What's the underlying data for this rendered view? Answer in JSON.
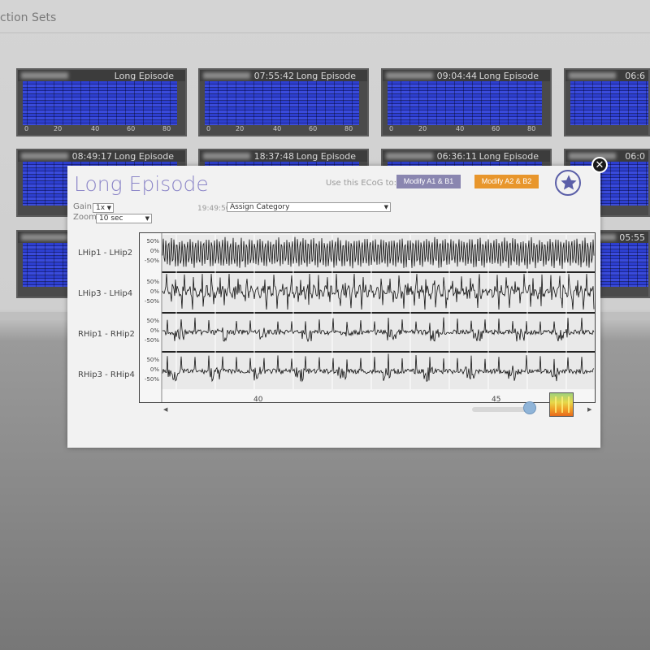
{
  "background": {
    "page_title": "ction Sets",
    "thumbnails": [
      {
        "time": "",
        "title": "Long Episode"
      },
      {
        "time": "07:55:42",
        "title": "Long Episode"
      },
      {
        "time": "09:04:44",
        "title": "Long Episode"
      },
      {
        "time": "06:6",
        "title": ""
      },
      {
        "time": "08:49:17",
        "title": "Long Episode"
      },
      {
        "time": "18:37:48",
        "title": "Long Episode"
      },
      {
        "time": "06:36:11",
        "title": "Long Episode"
      },
      {
        "time": "06:0",
        "title": ""
      },
      {
        "time": "05:55",
        "title": ""
      }
    ],
    "axis_ticks": [
      "0",
      "20",
      "40",
      "60",
      "80"
    ]
  },
  "modal": {
    "title": "Long Episode",
    "use_label": "Use this ECoG to:",
    "modify_a1_label": "Modify A1 & B1",
    "modify_a2_label": "Modify A2 & B2",
    "gain_label": "Gain",
    "gain_value": "1x",
    "zoom_label": "Zoom",
    "zoom_value": "10 sec",
    "timestamp": "19:49:50",
    "category_placeholder": "Assign Category",
    "close_icon": "close-icon",
    "star_icon": "star-icon"
  },
  "channels": [
    {
      "label": "LHip1 - LHip2",
      "scale": [
        "50%",
        "0%",
        "-50%"
      ]
    },
    {
      "label": "LHip3 - LHip4",
      "scale": [
        "50%",
        "0%",
        "-50%"
      ]
    },
    {
      "label": "RHip1 - RHip2",
      "scale": [
        "50%",
        "0%",
        "-50%"
      ]
    },
    {
      "label": "RHip3 - RHip4",
      "scale": [
        "50%",
        "0%",
        "-50%"
      ]
    }
  ],
  "x_ticks": [
    "40",
    "45"
  ],
  "colors": {
    "title": "#8c86c8",
    "a1_button": "#8a86b0",
    "a2_button": "#e8962c",
    "waveform": "#111111"
  }
}
